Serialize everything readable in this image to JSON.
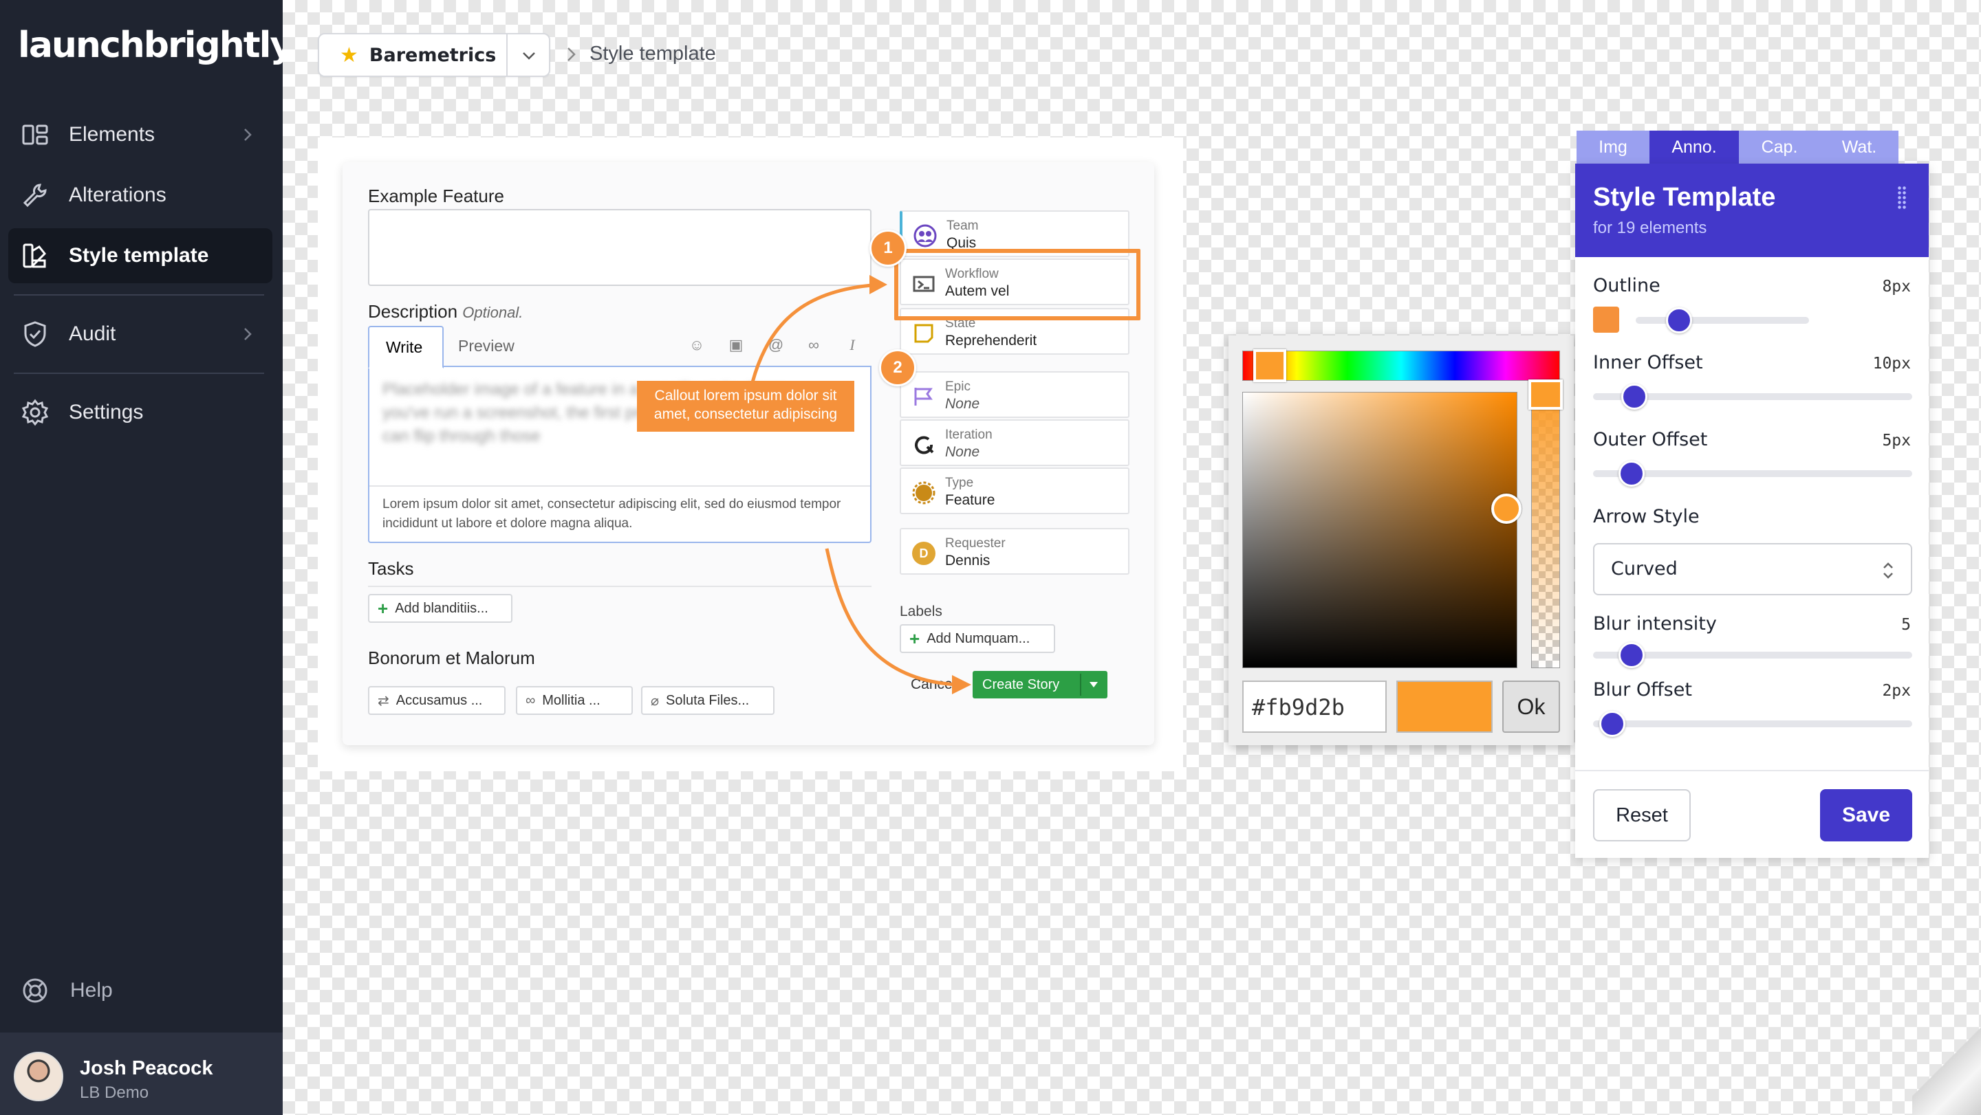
{
  "app": {
    "logo": "launchbrightly"
  },
  "sidebar": {
    "items": [
      {
        "label": "Elements"
      },
      {
        "label": "Alterations"
      },
      {
        "label": "Style template"
      },
      {
        "label": "Audit"
      },
      {
        "label": "Settings"
      }
    ],
    "help_label": "Help",
    "user": {
      "name": "Josh Peacock",
      "org": "LB Demo"
    }
  },
  "breadcrumb": {
    "project": "Baremetrics",
    "page": "Style template"
  },
  "screenshot": {
    "feature_label": "Example Feature",
    "description_label": "Description",
    "description_optional": "Optional.",
    "tab_write": "Write",
    "tab_preview": "Preview",
    "blurred_text": "Placeholder image of a feature in a specific style. Once you've run a screenshot, the first product images, you can flip through those",
    "lorem": "Lorem ipsum dolor sit amet, consectetur adipiscing elit, sed do eiusmod tempor incididunt ut labore et dolore magna aliqua.",
    "tasks_label": "Tasks",
    "add_task": "Add blanditiis...",
    "bonorum_label": "Bonorum et Malorum",
    "pills": [
      "Accusamus ...",
      "Mollitia ...",
      "Soluta Files..."
    ],
    "fields": [
      {
        "key": "Team",
        "value": "Quis"
      },
      {
        "key": "Workflow",
        "value": "Autem vel"
      },
      {
        "key": "State",
        "value": "Reprehenderit"
      },
      {
        "key": "Epic",
        "value": "None"
      },
      {
        "key": "Iteration",
        "value": "None"
      },
      {
        "key": "Type",
        "value": "Feature"
      },
      {
        "key": "Requester",
        "value": "Dennis"
      }
    ],
    "requester_initial": "D",
    "labels_label": "Labels",
    "add_label": "Add Numquam...",
    "cancel": "Cancel",
    "create_story": "Create Story",
    "callout_text": "Callout lorem ipsum dolor sit amet, consectetur adipiscing",
    "badge_1": "1",
    "badge_2": "2",
    "accent_color": "#f5913b"
  },
  "picker": {
    "hex": "#fb9d2b",
    "ok_label": "Ok",
    "color": "#fb9d2b"
  },
  "panel": {
    "tabs": [
      "Img",
      "Anno.",
      "Cap.",
      "Wat."
    ],
    "active_tab": "Anno.",
    "title": "Style Template",
    "subtitle": "for 19 elements",
    "outline": {
      "label": "Outline",
      "value": "8px",
      "level": 0.25
    },
    "inner_offset": {
      "label": "Inner Offset",
      "value": "10px",
      "level": 0.13
    },
    "outer_offset": {
      "label": "Outer Offset",
      "value": "5px",
      "level": 0.08
    },
    "arrow_style": {
      "label": "Arrow Style",
      "value": "Curved"
    },
    "blur_intensity": {
      "label": "Blur intensity",
      "value": "5",
      "level": 0.08
    },
    "blur_offset": {
      "label": "Blur Offset",
      "value": "2px",
      "level": 0.02
    },
    "reset_label": "Reset",
    "save_label": "Save",
    "brand_color": "#4338ca"
  }
}
